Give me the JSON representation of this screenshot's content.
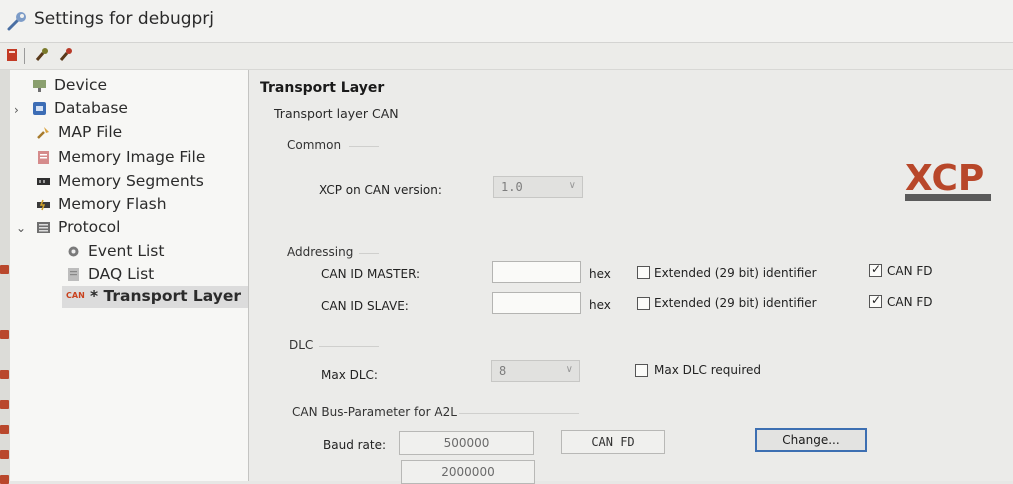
{
  "window": {
    "title": "Settings for debugprj"
  },
  "toolbar": {
    "buttons": [
      "close-book-icon",
      "brush-icon",
      "brush-red-icon"
    ]
  },
  "tree": {
    "items": [
      {
        "label": "Device",
        "icon": "device-icon"
      },
      {
        "label": "Database",
        "icon": "database-icon",
        "expandable": true
      },
      {
        "label": "MAP File",
        "icon": "map-file-icon"
      },
      {
        "label": "Memory Image File",
        "icon": "memory-image-icon"
      },
      {
        "label": "Memory Segments",
        "icon": "memory-segments-icon"
      },
      {
        "label": "Memory Flash",
        "icon": "memory-flash-icon"
      },
      {
        "label": "Protocol",
        "icon": "protocol-icon",
        "expanded": true
      },
      {
        "label": "Event List",
        "icon": "event-list-icon"
      },
      {
        "label": "DAQ List",
        "icon": "daq-list-icon"
      },
      {
        "label": "* Transport Layer",
        "icon": "can-icon",
        "badge": "CAN",
        "selected": true
      }
    ]
  },
  "main": {
    "title": "Transport Layer",
    "subtitle": "Transport layer CAN",
    "logo_text": "XCP",
    "common": {
      "group_label": "Common",
      "version_label": "XCP on CAN version:",
      "version_value": "1.0"
    },
    "addressing": {
      "group_label": "Addressing",
      "rows": [
        {
          "label": "CAN ID MASTER:",
          "value": "",
          "unit": "hex",
          "extended_label": "Extended (29 bit) identifier",
          "extended_checked": false,
          "canfd_label": "CAN FD",
          "canfd_checked": true
        },
        {
          "label": "CAN ID SLAVE:",
          "value": "",
          "unit": "hex",
          "extended_label": "Extended (29 bit) identifier",
          "extended_checked": false,
          "canfd_label": "CAN FD",
          "canfd_checked": true
        }
      ]
    },
    "dlc": {
      "group_label": "DLC",
      "max_dlc_label": "Max DLC:",
      "max_dlc_value": "8",
      "required_label": "Max DLC required",
      "required_checked": false
    },
    "bus": {
      "group_label": "CAN Bus-Parameter for A2L",
      "baud_label": "Baud rate:",
      "baud_value": "500000",
      "data_baud_value": "2000000",
      "mode_value": "CAN FD",
      "change_label": "Change..."
    }
  },
  "colors": {
    "accent": "#3d6fb2",
    "badge": "#c9421e",
    "logo": "#b8472a"
  }
}
